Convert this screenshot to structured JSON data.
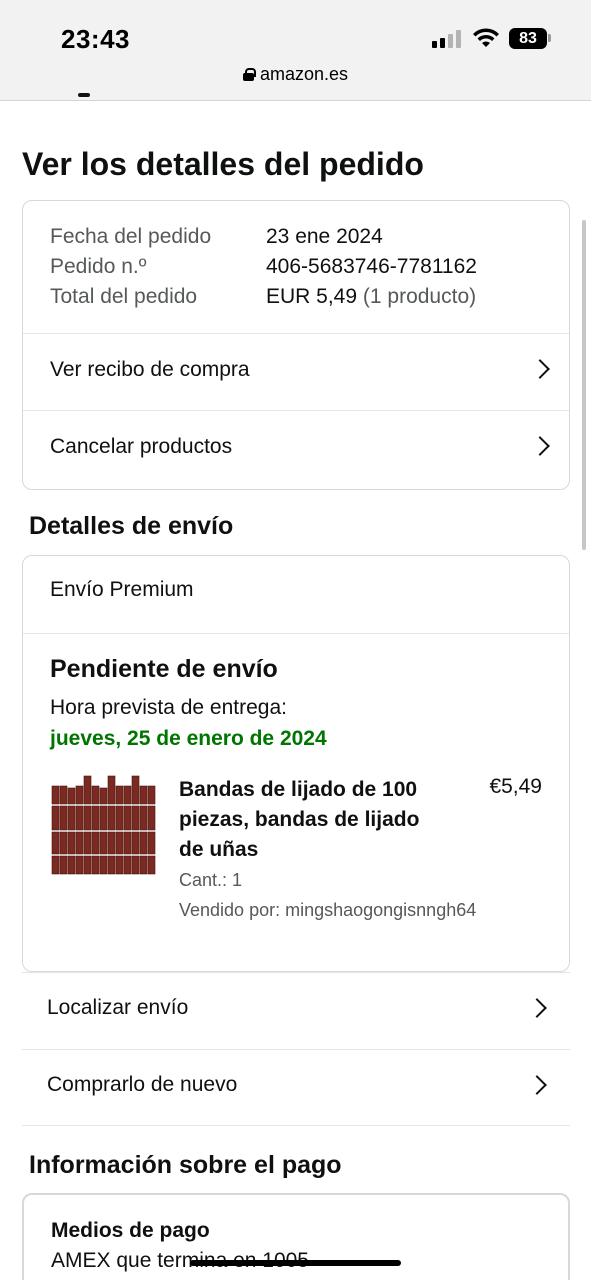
{
  "status_bar": {
    "time": "23:43",
    "battery": "83"
  },
  "browser": {
    "url": "amazon.es"
  },
  "page": {
    "title": "Ver los detalles del pedido"
  },
  "order_summary": {
    "date_label": "Fecha del pedido",
    "date_value": "23 ene 2024",
    "number_label": "Pedido n.º",
    "number_value": "406-5683746-7781162",
    "total_label": "Total del pedido",
    "total_value": "EUR 5,49",
    "total_count": "(1 producto)"
  },
  "order_links": {
    "receipt": "Ver recibo de compra",
    "cancel": "Cancelar productos"
  },
  "shipping": {
    "heading": "Detalles de envío",
    "type": "Envío Premium",
    "status": "Pendiente de envío",
    "eta_label": "Hora prevista de entrega:",
    "eta_date": "jueves, 25 de enero de 2024",
    "eta_color": "#007600",
    "product": {
      "title": "Bandas de lijado de 100 piezas, bandas de lijado de uñas",
      "price": "€5,49",
      "qty": "Cant.: 1",
      "seller": "Vendido por: mingshaogongisnngh64",
      "image_icon": "sanding-bands-image"
    }
  },
  "shipment_links": {
    "track": "Localizar envío",
    "buy_again": "Comprarlo de nuevo"
  },
  "payment": {
    "heading": "Información sobre el pago",
    "methods_label": "Medios de pago",
    "methods_value": "AMEX  que termina en 1005"
  }
}
